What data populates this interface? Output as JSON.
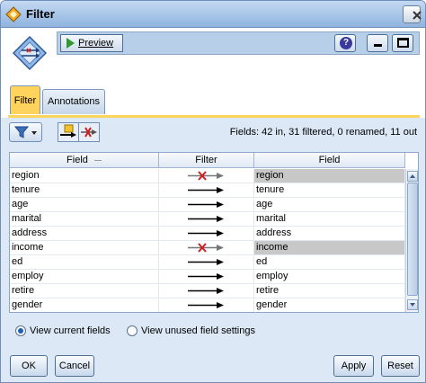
{
  "window": {
    "title": "Filter"
  },
  "toolbar": {
    "preview_label": "Preview",
    "help_glyph": "?"
  },
  "tabs": [
    {
      "label": "Filter"
    },
    {
      "label": "Annotations"
    }
  ],
  "summary": "Fields: 42 in, 31 filtered, 0 renamed, 11 out",
  "grid": {
    "headers": [
      "Field",
      "Filter",
      "Field"
    ],
    "rows": [
      {
        "in": "region",
        "out": "region",
        "filtered": true
      },
      {
        "in": "tenure",
        "out": "tenure",
        "filtered": false
      },
      {
        "in": "age",
        "out": "age",
        "filtered": false
      },
      {
        "in": "marital",
        "out": "marital",
        "filtered": false
      },
      {
        "in": "address",
        "out": "address",
        "filtered": false
      },
      {
        "in": "income",
        "out": "income",
        "filtered": true
      },
      {
        "in": "ed",
        "out": "ed",
        "filtered": false
      },
      {
        "in": "employ",
        "out": "employ",
        "filtered": false
      },
      {
        "in": "retire",
        "out": "retire",
        "filtered": false
      },
      {
        "in": "gender",
        "out": "gender",
        "filtered": false
      }
    ]
  },
  "options": {
    "view_current": "View current fields",
    "view_unused": "View unused field settings",
    "selected": "view_current"
  },
  "buttons": {
    "ok": "OK",
    "cancel": "Cancel",
    "apply": "Apply",
    "reset": "Reset"
  },
  "icons": {
    "title": "filter-node-icon",
    "close": "close-icon",
    "node": "filter-node-icon",
    "preview": "play-icon",
    "help": "help-icon",
    "minimize": "minimize-icon",
    "maximize": "maximize-icon",
    "filter_dropdown": "funnel-icon",
    "remove_new": "remove-new-fields-icon",
    "include_filtered": "include-filtered-icon",
    "sort": "sort-indicator-icon",
    "pass": "arrow-pass-icon",
    "blocked": "arrow-blocked-icon"
  },
  "colors": {
    "active_tab": "#ffd35c",
    "filtered_row": "#c8c8c8",
    "panel": "#dce8f6"
  }
}
